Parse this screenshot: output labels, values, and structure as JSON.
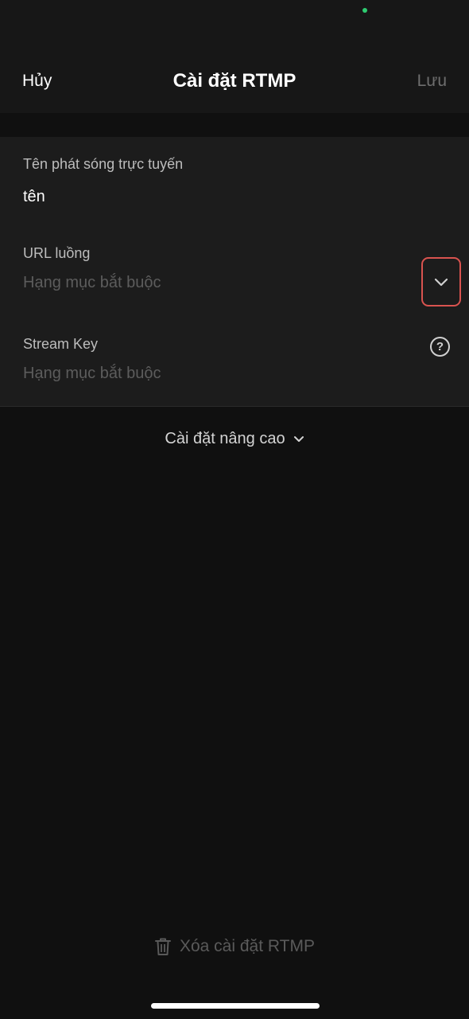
{
  "header": {
    "cancel_label": "Hủy",
    "title": "Cài đặt RTMP",
    "save_label": "Lưu"
  },
  "form": {
    "broadcast_name": {
      "label": "Tên phát sóng trực tuyến",
      "value": "tên"
    },
    "stream_url": {
      "label": "URL luồng",
      "placeholder": "Hạng mục bắt buộc",
      "dropdown_icon": "chevron-down-icon"
    },
    "stream_key": {
      "label": "Stream Key",
      "placeholder": "Hạng mục bắt buộc",
      "help_icon": "help-circle-icon",
      "help_glyph": "?"
    }
  },
  "advanced": {
    "label": "Cài đặt nâng cao",
    "icon": "chevron-down-icon"
  },
  "delete": {
    "label": "Xóa cài đặt RTMP",
    "icon": "trash-icon"
  },
  "colors": {
    "background": "#101010",
    "card": "#1c1c1c",
    "highlight_border": "#d9534f",
    "status_dot": "#2ecc71"
  }
}
